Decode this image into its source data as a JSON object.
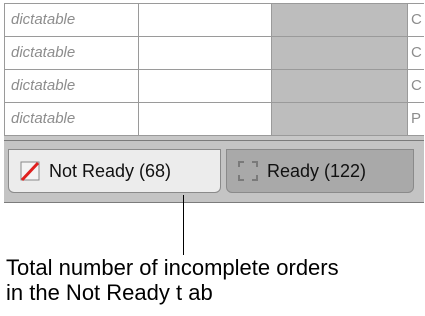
{
  "table": {
    "rows": [
      {
        "col1": "dictatable",
        "col4": "C"
      },
      {
        "col1": "dictatable",
        "col4": "C"
      },
      {
        "col1": "dictatable",
        "col4": "C"
      },
      {
        "col1": "dictatable",
        "col4": "P"
      }
    ]
  },
  "tabs": [
    {
      "label": "Not Ready (68)",
      "icon": "not-ready-icon",
      "active": true
    },
    {
      "label": "Ready (122)",
      "icon": "ready-icon",
      "active": false
    }
  ],
  "callout": {
    "line1": "Total number of incomplete orders",
    "line2": "in the Not Ready t ab"
  }
}
